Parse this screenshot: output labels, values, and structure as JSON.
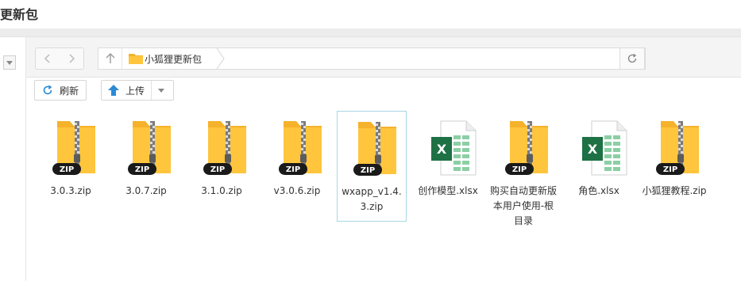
{
  "page": {
    "title": "更新包"
  },
  "nav": {
    "path_label": "小狐狸更新包"
  },
  "toolbar": {
    "refresh_label": "刷新",
    "upload_label": "上传"
  },
  "files": [
    {
      "name": "3.0.3.zip",
      "type": "zip"
    },
    {
      "name": "3.0.7.zip",
      "type": "zip"
    },
    {
      "name": "3.1.0.zip",
      "type": "zip"
    },
    {
      "name": "v3.0.6.zip",
      "type": "zip"
    },
    {
      "name": "wxapp_v1.4.3.zip",
      "type": "zip"
    },
    {
      "name": "创作模型.xlsx",
      "type": "xlsx"
    },
    {
      "name": "购买自动更新版本用户使用-根目录",
      "type": "zip"
    },
    {
      "name": "角色.xlsx",
      "type": "xlsx"
    },
    {
      "name": "小狐狸教程.zip",
      "type": "zip"
    }
  ],
  "icons": {
    "zip_badge": "ZIP",
    "excel_letter": "X"
  },
  "colors": {
    "folder": "#f9c240",
    "excel_green": "#1e7145",
    "selection_border": "#a9d6e5",
    "toolbar_bg": "#f4f4f4"
  }
}
